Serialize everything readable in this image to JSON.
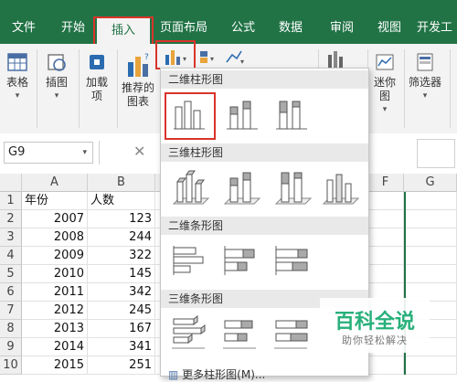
{
  "tabs": [
    "文件",
    "开始",
    "插入",
    "页面布局",
    "公式",
    "数据",
    "审阅",
    "视图",
    "开发工"
  ],
  "active_tab": "插入",
  "ribbon": {
    "table": "表格",
    "illustrations": "插图",
    "addins_line1": "加载",
    "addins_line2": "项",
    "recommended_line1": "推荐的",
    "recommended_line2": "图表",
    "sparklines": "迷你图",
    "filters": "筛选器"
  },
  "formula_bar": {
    "name_box": "G9"
  },
  "columns": [
    "A",
    "B",
    "F",
    "G"
  ],
  "rows": [
    {
      "num": "1",
      "a": "年份",
      "b": "人数"
    },
    {
      "num": "2",
      "a": "2007",
      "b": "123"
    },
    {
      "num": "3",
      "a": "2008",
      "b": "244"
    },
    {
      "num": "4",
      "a": "2009",
      "b": "322"
    },
    {
      "num": "5",
      "a": "2010",
      "b": "145"
    },
    {
      "num": "6",
      "a": "2011",
      "b": "342"
    },
    {
      "num": "7",
      "a": "2012",
      "b": "245"
    },
    {
      "num": "8",
      "a": "2013",
      "b": "167"
    },
    {
      "num": "9",
      "a": "2014",
      "b": "341"
    },
    {
      "num": "10",
      "a": "2015",
      "b": "251"
    }
  ],
  "dropdown": {
    "section_2d_column": "二维柱形图",
    "section_3d_column": "三维柱形图",
    "section_2d_bar": "二维条形图",
    "section_3d_bar": "三维条形图",
    "more": "更多柱形图(M)..."
  },
  "watermark": {
    "main": "百科全说",
    "sub": "助你轻松解决"
  },
  "colors": {
    "accent": "#217346",
    "highlight": "#d9342b",
    "watermark": "#27b07a"
  }
}
